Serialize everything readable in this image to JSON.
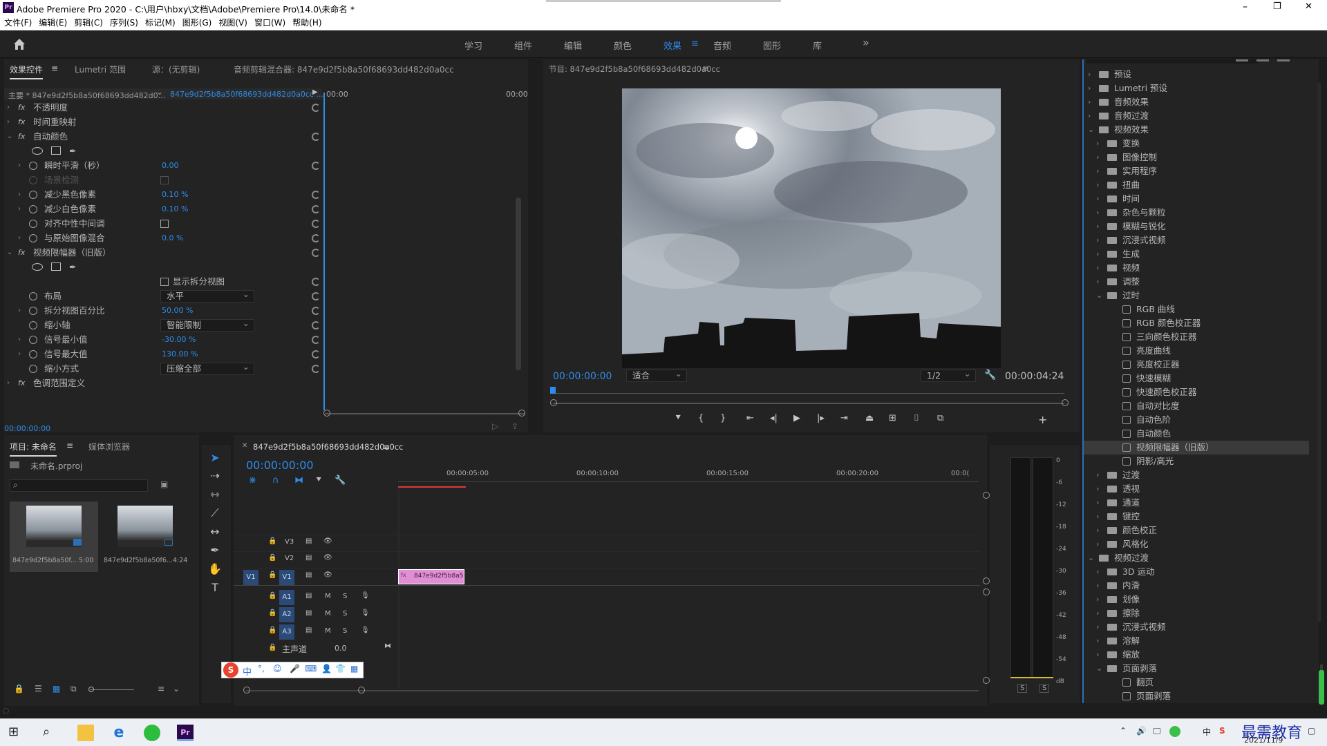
{
  "title_bar": {
    "title": "Adobe Premiere Pro 2020 - C:\\用户\\hbxy\\文档\\Adobe\\Premiere Pro\\14.0\\未命名 *",
    "icon": "Pr",
    "minimize": "–",
    "maximize": "❐",
    "close": "✕"
  },
  "menu": [
    "文件(F)",
    "编辑(E)",
    "剪辑(C)",
    "序列(S)",
    "标记(M)",
    "图形(G)",
    "视图(V)",
    "窗口(W)",
    "帮助(H)"
  ],
  "workspaces": [
    "学习",
    "组件",
    "编辑",
    "颜色",
    "效果",
    "音频",
    "图形",
    "库"
  ],
  "workspace_more": "»",
  "effect_controls": {
    "tabs": [
      "效果控件",
      "Lumetri 范围",
      "源：(无剪辑)",
      "音频剪辑混合器: 847e9d2f5b8a50f68693dd482d0a0cc"
    ],
    "header_source": "主要 * 847e9d2f5b8a50f68693dd482d0...",
    "header_clip": "847e9d2f5b8a50f68693dd482d0a0cc ...",
    "timecode_start": "00:00",
    "timecode_end": "00:00",
    "rows": [
      {
        "label": "不透明度",
        "value": "",
        "kind": "section"
      },
      {
        "label": "时间重映射",
        "value": "",
        "kind": "section"
      },
      {
        "label": "自动颜色",
        "value": "",
        "kind": "section-open"
      },
      {
        "label": "",
        "value": "",
        "kind": "shapes"
      },
      {
        "label": "瞬时平滑（秒）",
        "value": "0.00",
        "kind": "param"
      },
      {
        "label": "场景检测",
        "value": "",
        "kind": "checkbox-dim"
      },
      {
        "label": "减少黑色像素",
        "value": "0.10 %",
        "kind": "param"
      },
      {
        "label": "减少白色像素",
        "value": "0.10 %",
        "kind": "param"
      },
      {
        "label": "对齐中性中间调",
        "value": "",
        "kind": "checkbox"
      },
      {
        "label": "与原始图像混合",
        "value": "0.0 %",
        "kind": "param"
      },
      {
        "label": "视频限幅器（旧版）",
        "value": "",
        "kind": "section-open"
      },
      {
        "label": "",
        "value": "",
        "kind": "shapes"
      },
      {
        "label": "显示拆分视图",
        "value": "",
        "kind": "checkbox-right"
      },
      {
        "label": "布局",
        "value": "水平",
        "kind": "dropdown"
      },
      {
        "label": "拆分视图百分比",
        "value": "50.00 %",
        "kind": "param"
      },
      {
        "label": "缩小轴",
        "value": "智能限制",
        "kind": "dropdown"
      },
      {
        "label": "信号最小值",
        "value": "-30.00 %",
        "kind": "param"
      },
      {
        "label": "信号最大值",
        "value": "130.00 %",
        "kind": "param"
      },
      {
        "label": "缩小方式",
        "value": "压缩全部",
        "kind": "dropdown"
      },
      {
        "label": "色调范围定义",
        "value": "",
        "kind": "section"
      }
    ],
    "bottom_timecode": "00:00:00:00"
  },
  "program_monitor": {
    "title": "节目: 847e9d2f5b8a50f68693dd482d0a0cc",
    "timecode": "00:00:00:00",
    "fit": "适合",
    "resolution": "1/2",
    "duration": "00:00:04:24"
  },
  "project": {
    "tabs": [
      "项目: 未命名",
      "媒体浏览器"
    ],
    "file": "未命名.prproj",
    "search_placeholder": "",
    "items": [
      {
        "name": "847e9d2f5b8a50f...",
        "duration": "5:00"
      },
      {
        "name": "847e9d2f5b8a50f6...",
        "duration": "4:24"
      }
    ]
  },
  "timeline": {
    "tab": "847e9d2f5b8a50f68693dd482d0a0cc",
    "timecode": "00:00:00:00",
    "ruler": [
      "00:00:05:00",
      "00:00:10:00",
      "00:00:15:00",
      "00:00:20:00",
      "00:0("
    ],
    "video_tracks": [
      "V3",
      "V2",
      "V1"
    ],
    "audio_tracks": [
      "A1",
      "A2",
      "A3"
    ],
    "source_patch": "V1",
    "master_label": "主声道",
    "master_value": "0.0",
    "clip_label": "847e9d2f5b8a5",
    "mute": "M",
    "solo": "S"
  },
  "meter": {
    "scale": [
      "0",
      "-6",
      "-12",
      "-18",
      "-24",
      "-30",
      "-36",
      "-42",
      "-48",
      "-54",
      "dB"
    ],
    "solo": [
      "S",
      "S"
    ]
  },
  "effects_panel": {
    "items": [
      {
        "label": "预设",
        "level": 0,
        "type": "folder",
        "state": "closed"
      },
      {
        "label": "Lumetri 预设",
        "level": 0,
        "type": "folder",
        "state": "closed"
      },
      {
        "label": "音频效果",
        "level": 0,
        "type": "folder",
        "state": "closed"
      },
      {
        "label": "音频过渡",
        "level": 0,
        "type": "folder",
        "state": "closed"
      },
      {
        "label": "视频效果",
        "level": 0,
        "type": "folder",
        "state": "open"
      },
      {
        "label": "变换",
        "level": 1,
        "type": "folder",
        "state": "closed"
      },
      {
        "label": "图像控制",
        "level": 1,
        "type": "folder",
        "state": "closed"
      },
      {
        "label": "实用程序",
        "level": 1,
        "type": "folder",
        "state": "closed"
      },
      {
        "label": "扭曲",
        "level": 1,
        "type": "folder",
        "state": "closed"
      },
      {
        "label": "时间",
        "level": 1,
        "type": "folder",
        "state": "closed"
      },
      {
        "label": "杂色与颗粒",
        "level": 1,
        "type": "folder",
        "state": "closed"
      },
      {
        "label": "模糊与锐化",
        "level": 1,
        "type": "folder",
        "state": "closed"
      },
      {
        "label": "沉浸式视频",
        "level": 1,
        "type": "folder",
        "state": "closed"
      },
      {
        "label": "生成",
        "level": 1,
        "type": "folder",
        "state": "closed"
      },
      {
        "label": "视频",
        "level": 1,
        "type": "folder",
        "state": "closed"
      },
      {
        "label": "调整",
        "level": 1,
        "type": "folder",
        "state": "closed"
      },
      {
        "label": "过时",
        "level": 1,
        "type": "folder",
        "state": "open"
      },
      {
        "label": "RGB 曲线",
        "level": 2,
        "type": "effect"
      },
      {
        "label": "RGB 颜色校正器",
        "level": 2,
        "type": "effect"
      },
      {
        "label": "三向颜色校正器",
        "level": 2,
        "type": "effect"
      },
      {
        "label": "亮度曲线",
        "level": 2,
        "type": "effect"
      },
      {
        "label": "亮度校正器",
        "level": 2,
        "type": "effect"
      },
      {
        "label": "快速模糊",
        "level": 2,
        "type": "effect"
      },
      {
        "label": "快速颜色校正器",
        "level": 2,
        "type": "effect"
      },
      {
        "label": "自动对比度",
        "level": 2,
        "type": "effect"
      },
      {
        "label": "自动色阶",
        "level": 2,
        "type": "effect"
      },
      {
        "label": "自动颜色",
        "level": 2,
        "type": "effect"
      },
      {
        "label": "视频限幅器（旧版）",
        "level": 2,
        "type": "effect",
        "selected": true
      },
      {
        "label": "阴影/高光",
        "level": 2,
        "type": "effect"
      },
      {
        "label": "过渡",
        "level": 1,
        "type": "folder",
        "state": "closed"
      },
      {
        "label": "透视",
        "level": 1,
        "type": "folder",
        "state": "closed"
      },
      {
        "label": "通道",
        "level": 1,
        "type": "folder",
        "state": "closed"
      },
      {
        "label": "键控",
        "level": 1,
        "type": "folder",
        "state": "closed"
      },
      {
        "label": "颜色校正",
        "level": 1,
        "type": "folder",
        "state": "closed"
      },
      {
        "label": "风格化",
        "level": 1,
        "type": "folder",
        "state": "closed"
      },
      {
        "label": "视频过渡",
        "level": 0,
        "type": "folder",
        "state": "open"
      },
      {
        "label": "3D 运动",
        "level": 1,
        "type": "folder",
        "state": "closed"
      },
      {
        "label": "内滑",
        "level": 1,
        "type": "folder",
        "state": "closed"
      },
      {
        "label": "划像",
        "level": 1,
        "type": "folder",
        "state": "closed"
      },
      {
        "label": "擦除",
        "level": 1,
        "type": "folder",
        "state": "closed"
      },
      {
        "label": "沉浸式视频",
        "level": 1,
        "type": "folder",
        "state": "closed"
      },
      {
        "label": "溶解",
        "level": 1,
        "type": "folder",
        "state": "closed"
      },
      {
        "label": "缩放",
        "level": 1,
        "type": "folder",
        "state": "closed"
      },
      {
        "label": "页面剥落",
        "level": 1,
        "type": "folder",
        "state": "open"
      },
      {
        "label": "翻页",
        "level": 2,
        "type": "transition"
      },
      {
        "label": "页面剥落",
        "level": 2,
        "type": "transition"
      }
    ]
  },
  "ime_toolbar": {
    "brand": "S",
    "lang": "中",
    "punct": "°,"
  },
  "taskbar": {
    "date": "2021/11/9",
    "watermark": "最需教育",
    "lang_indicator": "中"
  }
}
